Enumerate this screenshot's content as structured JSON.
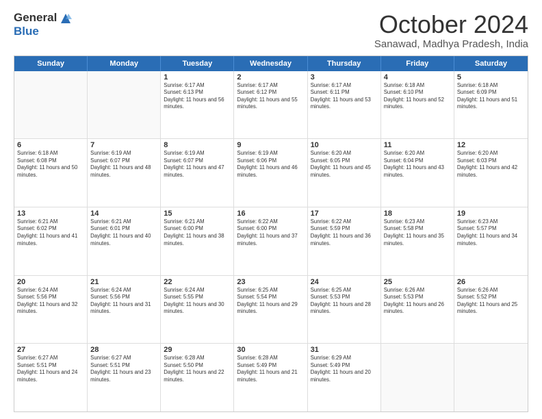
{
  "logo": {
    "general": "General",
    "blue": "Blue"
  },
  "title": "October 2024",
  "subtitle": "Sanawad, Madhya Pradesh, India",
  "header_days": [
    "Sunday",
    "Monday",
    "Tuesday",
    "Wednesday",
    "Thursday",
    "Friday",
    "Saturday"
  ],
  "weeks": [
    [
      {
        "day": "",
        "info": ""
      },
      {
        "day": "",
        "info": ""
      },
      {
        "day": "1",
        "info": "Sunrise: 6:17 AM\nSunset: 6:13 PM\nDaylight: 11 hours and 56 minutes."
      },
      {
        "day": "2",
        "info": "Sunrise: 6:17 AM\nSunset: 6:12 PM\nDaylight: 11 hours and 55 minutes."
      },
      {
        "day": "3",
        "info": "Sunrise: 6:17 AM\nSunset: 6:11 PM\nDaylight: 11 hours and 53 minutes."
      },
      {
        "day": "4",
        "info": "Sunrise: 6:18 AM\nSunset: 6:10 PM\nDaylight: 11 hours and 52 minutes."
      },
      {
        "day": "5",
        "info": "Sunrise: 6:18 AM\nSunset: 6:09 PM\nDaylight: 11 hours and 51 minutes."
      }
    ],
    [
      {
        "day": "6",
        "info": "Sunrise: 6:18 AM\nSunset: 6:08 PM\nDaylight: 11 hours and 50 minutes."
      },
      {
        "day": "7",
        "info": "Sunrise: 6:19 AM\nSunset: 6:07 PM\nDaylight: 11 hours and 48 minutes."
      },
      {
        "day": "8",
        "info": "Sunrise: 6:19 AM\nSunset: 6:07 PM\nDaylight: 11 hours and 47 minutes."
      },
      {
        "day": "9",
        "info": "Sunrise: 6:19 AM\nSunset: 6:06 PM\nDaylight: 11 hours and 46 minutes."
      },
      {
        "day": "10",
        "info": "Sunrise: 6:20 AM\nSunset: 6:05 PM\nDaylight: 11 hours and 45 minutes."
      },
      {
        "day": "11",
        "info": "Sunrise: 6:20 AM\nSunset: 6:04 PM\nDaylight: 11 hours and 43 minutes."
      },
      {
        "day": "12",
        "info": "Sunrise: 6:20 AM\nSunset: 6:03 PM\nDaylight: 11 hours and 42 minutes."
      }
    ],
    [
      {
        "day": "13",
        "info": "Sunrise: 6:21 AM\nSunset: 6:02 PM\nDaylight: 11 hours and 41 minutes."
      },
      {
        "day": "14",
        "info": "Sunrise: 6:21 AM\nSunset: 6:01 PM\nDaylight: 11 hours and 40 minutes."
      },
      {
        "day": "15",
        "info": "Sunrise: 6:21 AM\nSunset: 6:00 PM\nDaylight: 11 hours and 38 minutes."
      },
      {
        "day": "16",
        "info": "Sunrise: 6:22 AM\nSunset: 6:00 PM\nDaylight: 11 hours and 37 minutes."
      },
      {
        "day": "17",
        "info": "Sunrise: 6:22 AM\nSunset: 5:59 PM\nDaylight: 11 hours and 36 minutes."
      },
      {
        "day": "18",
        "info": "Sunrise: 6:23 AM\nSunset: 5:58 PM\nDaylight: 11 hours and 35 minutes."
      },
      {
        "day": "19",
        "info": "Sunrise: 6:23 AM\nSunset: 5:57 PM\nDaylight: 11 hours and 34 minutes."
      }
    ],
    [
      {
        "day": "20",
        "info": "Sunrise: 6:24 AM\nSunset: 5:56 PM\nDaylight: 11 hours and 32 minutes."
      },
      {
        "day": "21",
        "info": "Sunrise: 6:24 AM\nSunset: 5:56 PM\nDaylight: 11 hours and 31 minutes."
      },
      {
        "day": "22",
        "info": "Sunrise: 6:24 AM\nSunset: 5:55 PM\nDaylight: 11 hours and 30 minutes."
      },
      {
        "day": "23",
        "info": "Sunrise: 6:25 AM\nSunset: 5:54 PM\nDaylight: 11 hours and 29 minutes."
      },
      {
        "day": "24",
        "info": "Sunrise: 6:25 AM\nSunset: 5:53 PM\nDaylight: 11 hours and 28 minutes."
      },
      {
        "day": "25",
        "info": "Sunrise: 6:26 AM\nSunset: 5:53 PM\nDaylight: 11 hours and 26 minutes."
      },
      {
        "day": "26",
        "info": "Sunrise: 6:26 AM\nSunset: 5:52 PM\nDaylight: 11 hours and 25 minutes."
      }
    ],
    [
      {
        "day": "27",
        "info": "Sunrise: 6:27 AM\nSunset: 5:51 PM\nDaylight: 11 hours and 24 minutes."
      },
      {
        "day": "28",
        "info": "Sunrise: 6:27 AM\nSunset: 5:51 PM\nDaylight: 11 hours and 23 minutes."
      },
      {
        "day": "29",
        "info": "Sunrise: 6:28 AM\nSunset: 5:50 PM\nDaylight: 11 hours and 22 minutes."
      },
      {
        "day": "30",
        "info": "Sunrise: 6:28 AM\nSunset: 5:49 PM\nDaylight: 11 hours and 21 minutes."
      },
      {
        "day": "31",
        "info": "Sunrise: 6:29 AM\nSunset: 5:49 PM\nDaylight: 11 hours and 20 minutes."
      },
      {
        "day": "",
        "info": ""
      },
      {
        "day": "",
        "info": ""
      }
    ]
  ]
}
